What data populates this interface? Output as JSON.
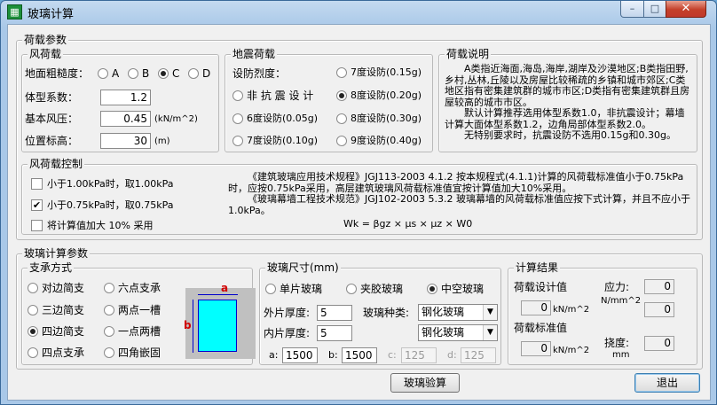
{
  "window": {
    "title": "玻璃计算",
    "app_icon": "grid-icon",
    "min_label": "–",
    "max_label": "□",
    "close_label": "✕"
  },
  "load_params": {
    "legend": "荷载参数",
    "wind": {
      "legend": "风荷载",
      "roughness_label": "地面粗糙度：",
      "roughness_options": [
        "A",
        "B",
        "C",
        "D"
      ],
      "roughness_selected": "C",
      "shape_coef_label": "体型系数：",
      "shape_coef_value": "1.2",
      "base_pressure_label": "基本风压：",
      "base_pressure_value": "0.45",
      "base_pressure_unit": "(kN/m^2)",
      "height_label": "位置标高：",
      "height_value": "30",
      "height_unit": "(m)"
    },
    "seismic": {
      "legend": "地震荷载",
      "intensity_label": "设防烈度：",
      "options": [
        "非 抗 震 设 计",
        "6度设防(0.05g)",
        "7度设防(0.10g)",
        "7度设防(0.15g)",
        "8度设防(0.20g)",
        "8度设防(0.30g)",
        "9度设防(0.40g)"
      ],
      "selected": "8度设防(0.20g)"
    },
    "notes": {
      "legend": "荷载说明",
      "text_1": "A类指近海面,海岛,海岸,湖岸及沙漠地区;B类指田野,乡村,丛林,丘陵以及房屋比较稀疏的乡镇和城市郊区;C类地区指有密集建筑群的城市市区;D类指有密集建筑群且房屋较高的城市市区。",
      "text_2": "默认计算推荐选用体型系数1.0，非抗震设计；幕墙计算大面体型系数1.2，边角局部体型系数2.0。",
      "text_3": "无特别要求时，抗震设防不选用0.15g和0.30g。"
    },
    "control": {
      "legend": "风荷载控制",
      "options": [
        {
          "label": "小于1.00kPa时，取1.00kPa",
          "checked": false
        },
        {
          "label": "小于0.75kPa时，取0.75kPa",
          "checked": true
        },
        {
          "label": "将计算值加大 10% 采用",
          "checked": false
        }
      ],
      "standard_text_1": "《建筑玻璃应用技术规程》JGJ113-2003  4.1.2 按本规程式(4.1.1)计算的风荷载标准值小于0.75kPa时，应按0.75kPa采用，高层建筑玻璃风荷载标准值宜按计算值加大10%采用。",
      "standard_text_2": "《玻璃幕墙工程技术规范》JGJ102-2003  5.3.2 玻璃幕墙的风荷载标准值应按下式计算，并且不应小于1.0kPa。",
      "formula": "Wk = βgz × μs × μz × W0"
    }
  },
  "glass_params": {
    "legend": "玻璃计算参数",
    "support": {
      "legend": "支承方式",
      "options": [
        "对边简支",
        "六点支承",
        "三边简支",
        "两点一槽",
        "四边简支",
        "一点两槽",
        "四点支承",
        "四角嵌固"
      ],
      "selected": "四边简支",
      "dim_a": "a",
      "dim_b": "b"
    },
    "size": {
      "legend": "玻璃尺寸(mm)",
      "types": [
        "单片玻璃",
        "夹胶玻璃",
        "中空玻璃"
      ],
      "type_selected": "中空玻璃",
      "outer_label": "外片厚度:",
      "outer_value": "5",
      "inner_label": "内片厚度:",
      "inner_value": "5",
      "kind_label": "玻璃种类:",
      "kind_outer": "钢化玻璃",
      "kind_inner": "钢化玻璃",
      "a_label": "a:",
      "a_value": "1500",
      "b_label": "b:",
      "b_value": "1500",
      "c_label": "c:",
      "c_value": "125",
      "d_label": "d:",
      "d_value": "125"
    },
    "results": {
      "legend": "计算结果",
      "design_label": "荷载设计值",
      "design_value": "0",
      "design_unit": "kN/m^2",
      "standard_label": "荷载标准值",
      "standard_value": "0",
      "standard_unit": "kN/m^2",
      "stress_label": "应力:",
      "stress_unit": "N/mm^2",
      "stress_values": [
        "0",
        "0"
      ],
      "deflection_label": "挠度:",
      "deflection_unit": "mm",
      "deflection_value": "0"
    }
  },
  "buttons": {
    "check": "玻璃验算",
    "exit": "退出"
  }
}
